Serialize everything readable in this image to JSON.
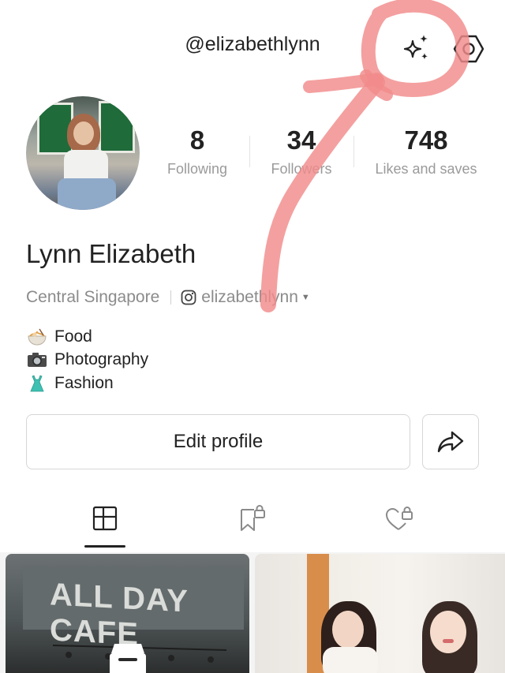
{
  "header": {
    "handle": "@elizabethlynn"
  },
  "icons": {
    "ai_sparkle": "sparkles-icon",
    "settings": "hexagon-settings-icon",
    "instagram": "instagram-icon",
    "share": "share-arrow-icon",
    "tab_notes": "grid-icon",
    "tab_collects": "bookmark-lock-icon",
    "tab_likes": "heart-lock-icon"
  },
  "profile": {
    "name": "Lynn Elizabeth",
    "location": "Central Singapore",
    "instagram": "elizabethlynn",
    "stats": [
      {
        "value": "8",
        "label": "Following"
      },
      {
        "value": "34",
        "label": "Followers"
      },
      {
        "value": "748",
        "label": "Likes and saves"
      }
    ],
    "interests": [
      {
        "emoji": "noodle-bowl-emoji",
        "label": "Food"
      },
      {
        "emoji": "camera-emoji",
        "label": "Photography"
      },
      {
        "emoji": "dress-emoji",
        "label": "Fashion"
      }
    ]
  },
  "actions": {
    "edit_profile": "Edit profile"
  },
  "feed": {
    "thumb1_text": "ALL DAY CAFE"
  },
  "colors": {
    "annotation": "#f28b8b",
    "text_primary": "#222222",
    "text_secondary": "#8b8b8b"
  }
}
